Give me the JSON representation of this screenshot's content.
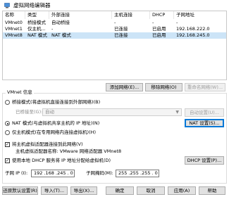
{
  "window": {
    "title": "虚拟网络编辑器",
    "icon": "vmware-network-icon"
  },
  "table": {
    "headers": [
      "名称",
      "类型",
      "外部连接",
      "主机连接",
      "DHCP",
      "子网地址"
    ],
    "rows": [
      {
        "name": "VMnet0",
        "type": "桥接模式",
        "external": "自动桥接",
        "host": "-",
        "dhcp": "-",
        "subnet": "-"
      },
      {
        "name": "VMnet1",
        "type": "仅主机...",
        "external": "-",
        "host": "已连接",
        "dhcp": "已启用",
        "subnet": "192.168.222.0"
      },
      {
        "name": "VMnet8",
        "type": "NAT 模式",
        "external": "NAT 模式",
        "host": "已连接",
        "dhcp": "已启用",
        "subnet": "192.168.245.0"
      }
    ]
  },
  "table_buttons": {
    "add": "添加网络(E)...",
    "remove": "移除网络(O)",
    "rename": "重命名网络(W)..."
  },
  "vmnet_info": {
    "group_label": "VMnet 信息",
    "bridged_label": "桥接模式(将虚拟机直接连接到外部网络)(B)",
    "bridged_to_label": "已桥接至(G):",
    "bridged_to_value": "自动",
    "auto_settings": "自动设置(U)...",
    "nat_label": "NAT 模式(与虚拟机共享主机的 IP 地址)(N)",
    "nat_settings": "NAT 设置(S)...",
    "hostonly_label": "仅主机模式(在专用网络内连接虚拟机)(H)",
    "connect_host_label": "将主机虚拟适配器连接到此网络(V)",
    "adapter_name_text": "主机虚拟适配器名称: VMware 网络适配器 VMnet8",
    "dhcp_label": "使用本地 DHCP 服务将 IP 地址分配给虚拟机(D)",
    "dhcp_settings": "DHCP 设置(P)...",
    "subnet_ip_label": "子网 IP (I):",
    "subnet_ip_value": "192 .168 .245 . 0",
    "subnet_mask_label": "子网掩码(M):",
    "subnet_mask_value": "255 .255 .255 . 0"
  },
  "bottom_buttons": {
    "restore": "还原默认设置(R)",
    "import": "导入(T)...",
    "export": "导出(X)...",
    "ok": "确定",
    "cancel": "取消",
    "apply": "应用(A)",
    "help": "帮助"
  },
  "colors": {
    "selection": "#cce4f7",
    "accent": "#0078d7",
    "button": "#e1e1e1"
  }
}
